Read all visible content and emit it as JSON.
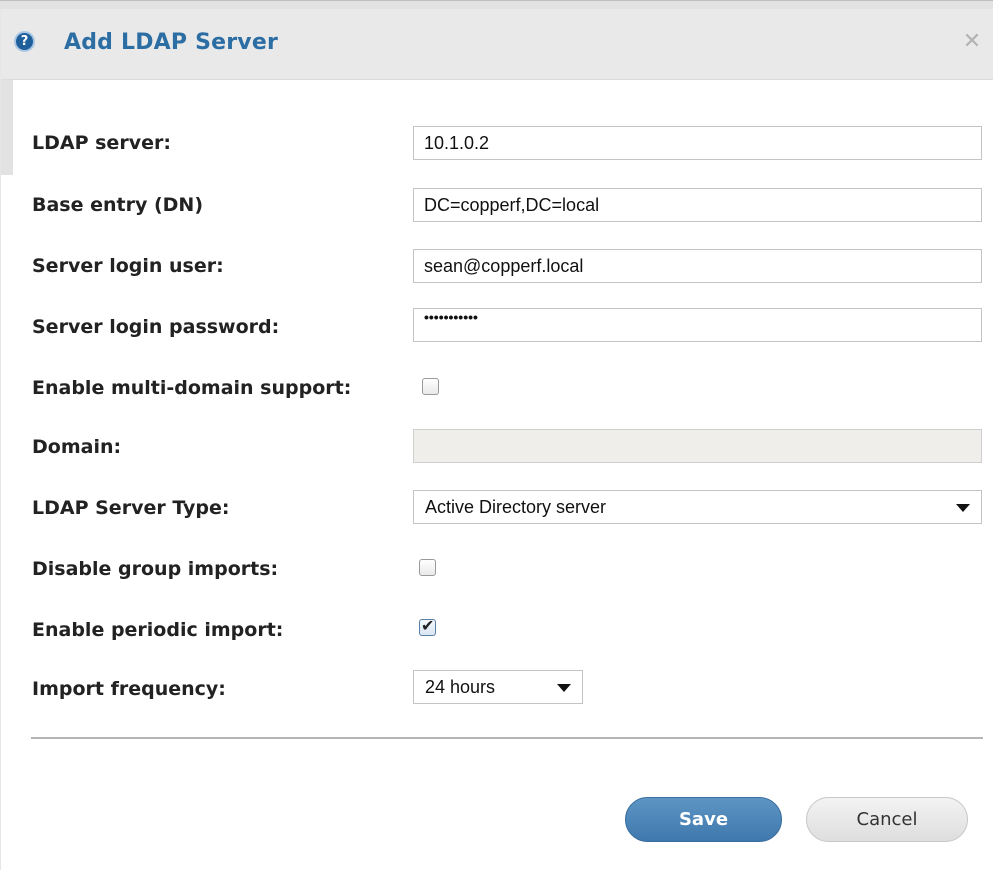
{
  "dialog": {
    "title": "Add LDAP Server",
    "help_icon_glyph": "?",
    "close_icon_glyph": "✕"
  },
  "form": {
    "ldap_server": {
      "label": "LDAP server:",
      "value": "10.1.0.2"
    },
    "base_entry": {
      "label": "Base entry (DN)",
      "value": "DC=copperf,DC=local"
    },
    "login_user": {
      "label": "Server login user:",
      "value": "sean@copperf.local"
    },
    "login_password": {
      "label": "Server login password:",
      "value": "•••••••••••"
    },
    "multi_domain": {
      "label": "Enable multi-domain support:",
      "checked": false
    },
    "domain": {
      "label": "Domain:",
      "value": "",
      "disabled": true
    },
    "server_type": {
      "label": "LDAP Server Type:",
      "selected": "Active Directory server"
    },
    "disable_group_imports": {
      "label": "Disable group imports:",
      "checked": false
    },
    "periodic_import": {
      "label": "Enable periodic import:",
      "checked": true,
      "check_glyph": "✔"
    },
    "import_frequency": {
      "label": "Import frequency:",
      "selected": "24 hours"
    }
  },
  "buttons": {
    "save": "Save",
    "cancel": "Cancel"
  },
  "colors": {
    "title": "#2c6ea4",
    "save_button": "#4a86bb",
    "titlebar_bg": "#e9e9e9"
  }
}
